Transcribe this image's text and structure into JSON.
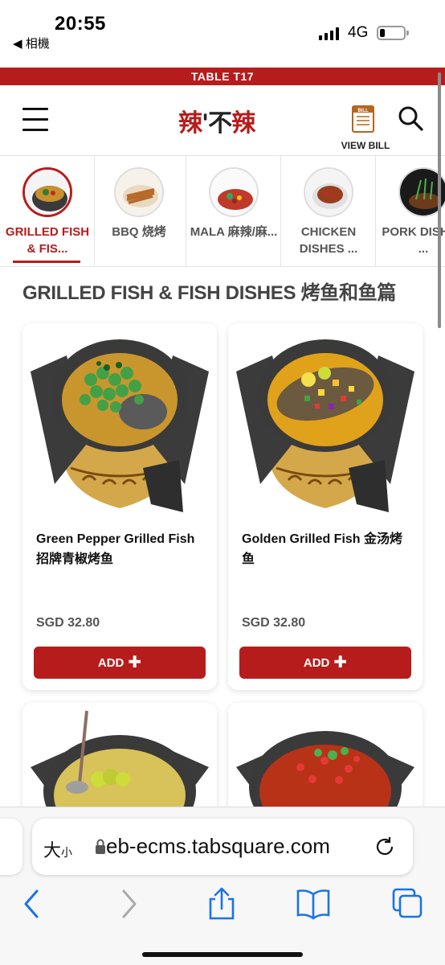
{
  "status_bar": {
    "time": "20:55",
    "back_label": "◀ 相機",
    "network": "4G",
    "battery_level": 0.2
  },
  "table_banner": "TABLE T17",
  "header": {
    "logo_icon": "restaurant-logo",
    "logo_text_red": "辣",
    "logo_text_dark": "'不",
    "logo_text_red2": "辣",
    "bill_label": "VIEW BILL",
    "menu_icon": "hamburger-icon",
    "search_icon": "search-icon"
  },
  "categories": [
    {
      "label": "GRILLED FISH & FIS...",
      "active": true
    },
    {
      "label": "BBQ 烧烤",
      "active": false
    },
    {
      "label": "MALA 麻辣/麻...",
      "active": false
    },
    {
      "label": "CHICKEN DISHES ...",
      "active": false
    },
    {
      "label": "PORK DISHES ...",
      "active": false
    }
  ],
  "section": {
    "title": "GRILLED FISH & FISH DISHES 烤鱼和鱼篇"
  },
  "items": [
    {
      "name": "Green Pepper Grilled Fish 招牌青椒烤鱼",
      "price": "SGD 32.80",
      "add_label": "ADD"
    },
    {
      "name": "Golden Grilled Fish 金汤烤鱼",
      "price": "SGD 32.80",
      "add_label": "ADD"
    }
  ],
  "browser": {
    "text_size_label": "大",
    "text_size_small": "小",
    "url": "eb-ecms.tabsquare.com"
  },
  "colors": {
    "brand": "#b71c1c",
    "text": "#222222"
  }
}
